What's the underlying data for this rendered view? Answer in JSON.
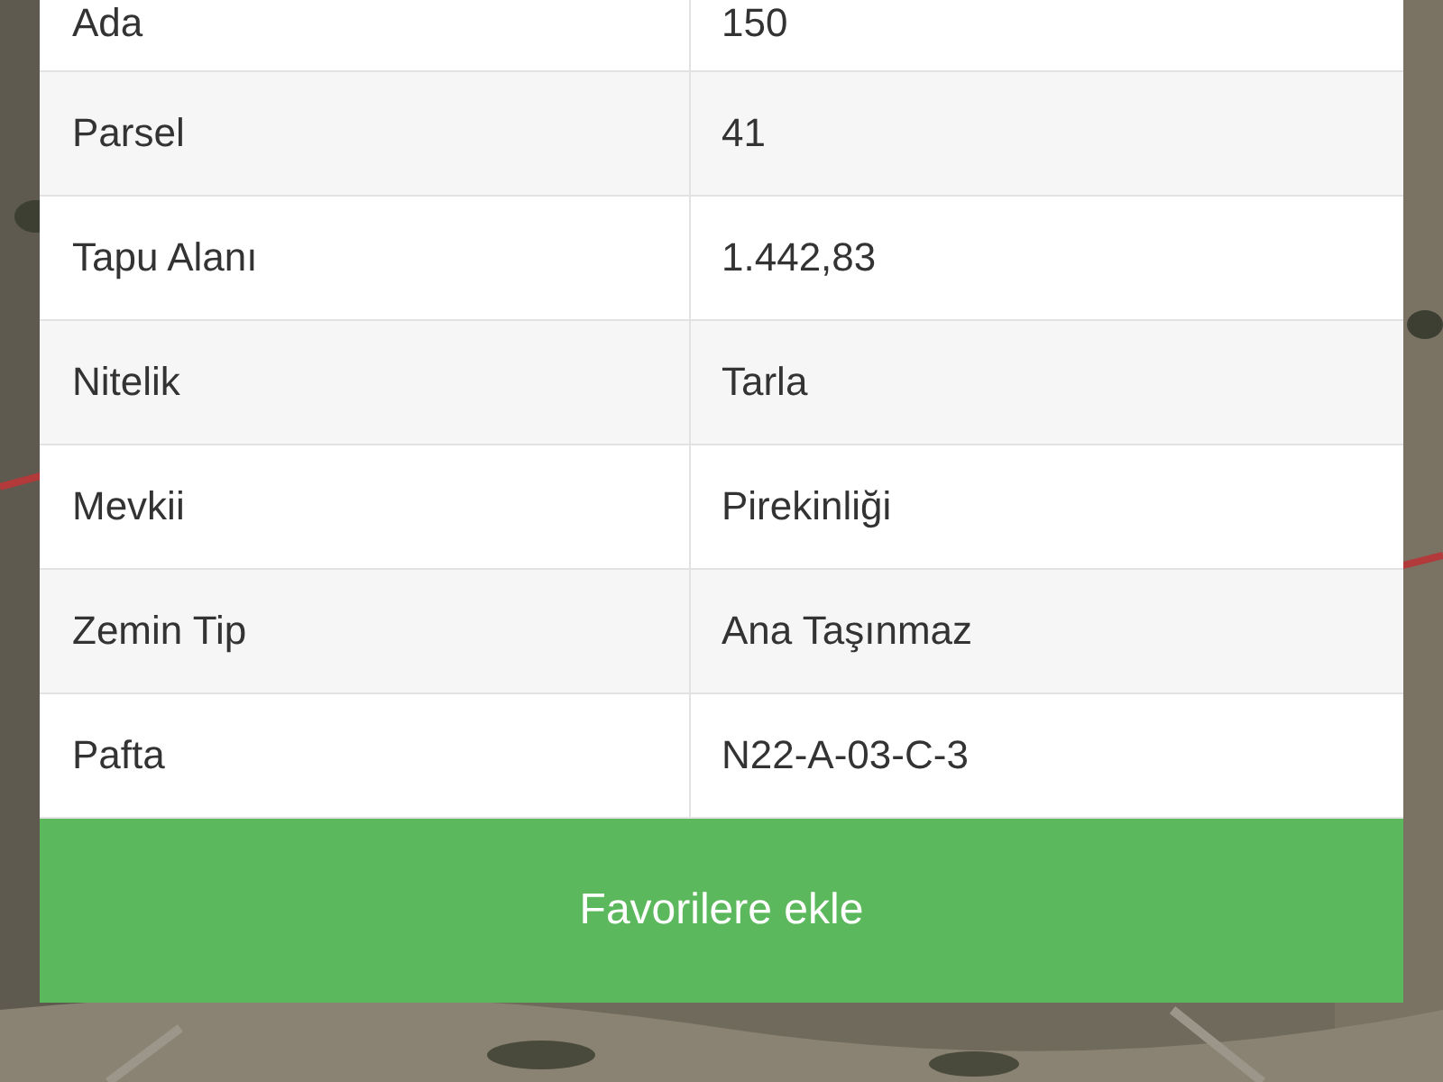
{
  "rows": [
    {
      "label": "Ada",
      "value": "150"
    },
    {
      "label": "Parsel",
      "value": "41"
    },
    {
      "label": "Tapu Alanı",
      "value": "1.442,83"
    },
    {
      "label": "Nitelik",
      "value": "Tarla"
    },
    {
      "label": "Mevkii",
      "value": "Pirekinliği"
    },
    {
      "label": "Zemin Tip",
      "value": "Ana Taşınmaz"
    },
    {
      "label": "Pafta",
      "value": "N22-A-03-C-3"
    }
  ],
  "button": {
    "label": "Favorilere ekle"
  }
}
